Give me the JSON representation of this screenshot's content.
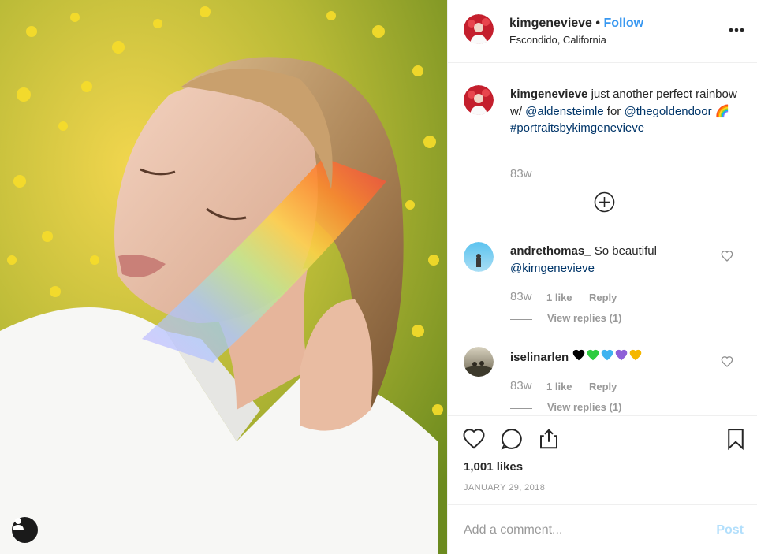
{
  "post": {
    "username": "kimgenevieve",
    "separator": "•",
    "follow_label": "Follow",
    "location": "Escondido, California"
  },
  "caption": {
    "username": "kimgenevieve",
    "text_1": " just another perfect rainbow w/ ",
    "mention_1": "@aldensteimle",
    "text_2": " for ",
    "mention_2": "@thegoldendoor",
    "emoji": "🌈",
    "hashtag": "#portraitsbykimgenevieve",
    "time": "83w"
  },
  "comments": [
    {
      "username": "andrethomas_",
      "text": " So beautiful ",
      "mention": "@kimgenevieve",
      "time": "83w",
      "likes": "1 like",
      "reply_label": "Reply",
      "view_replies": "View replies (1)"
    },
    {
      "username": "iselinarlen",
      "hearts": [
        "🖤",
        "💚",
        "💙",
        "💜",
        "💛"
      ],
      "heart_colors": [
        "#000000",
        "#2ecc40",
        "#3fb3f0",
        "#8e5fd8",
        "#f5b700"
      ],
      "time": "83w",
      "likes": "1 like",
      "reply_label": "Reply",
      "view_replies": "View replies (1)"
    }
  ],
  "engagement": {
    "likes": "1,001 likes",
    "date": "JANUARY 29, 2018"
  },
  "add_comment": {
    "placeholder": "Add a comment...",
    "post_label": "Post"
  },
  "icons": {
    "more": "more-options-icon",
    "load_more": "plus-circle-icon",
    "like": "heart-icon",
    "comment": "comment-icon",
    "share": "share-icon",
    "save": "bookmark-icon",
    "tag": "user-tag-icon"
  },
  "colors": {
    "link": "#003569",
    "follow": "#3897f0",
    "muted": "#999999",
    "post_disabled": "#b2dffc"
  }
}
